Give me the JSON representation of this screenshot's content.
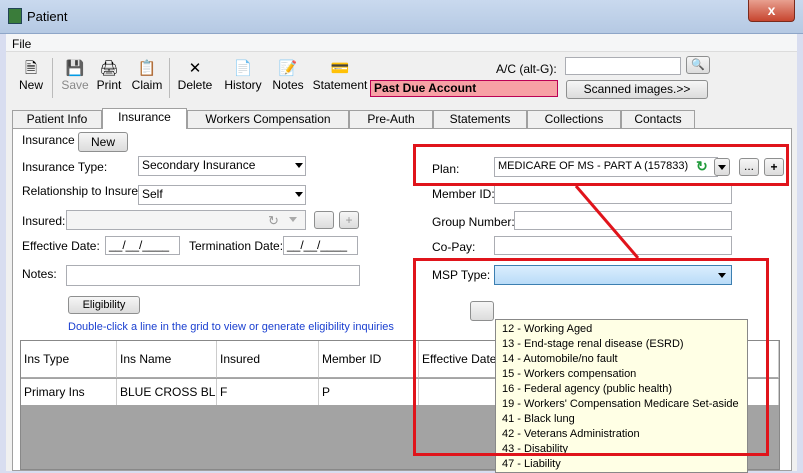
{
  "window": {
    "title": "Patient",
    "close": "x"
  },
  "menu": [
    "File"
  ],
  "toolbar": [
    {
      "label": "New",
      "icon": "new-doc-icon"
    },
    {
      "label": "Save",
      "icon": "save-icon"
    },
    {
      "label": "Print",
      "icon": "print-icon"
    },
    {
      "label": "Claim",
      "icon": "claim-icon"
    },
    {
      "label": "Delete",
      "icon": "delete-icon"
    },
    {
      "label": "History",
      "icon": "history-icon"
    },
    {
      "label": "Notes",
      "icon": "notes-icon"
    },
    {
      "label": "Statement",
      "icon": "statement-icon"
    }
  ],
  "account": {
    "past_due": "Past Due Account",
    "ac_label": "A/C (alt-G):",
    "ac_value": "",
    "scanned": "Scanned images.>>"
  },
  "tabs": [
    "Patient Info",
    "Insurance",
    "Workers Compensation",
    "Pre-Auth",
    "Statements",
    "Collections",
    "Contacts"
  ],
  "insurance": {
    "section": "Insurance",
    "new_btn": "New",
    "type_label": "Insurance Type:",
    "type_value": "Secondary Insurance",
    "relationship_label": "Relationship to Insured:",
    "relationship_value": "Self",
    "insured_label": "Insured:",
    "effective_label": "Effective Date:",
    "effective_value": "__/__/____",
    "termination_label": "Termination Date:",
    "termination_value": "__/__/____",
    "notes_label": "Notes:",
    "eligibility_btn": "Eligibility",
    "hint": "Double-click a line in the grid to view or generate eligibility inquiries",
    "plan_label": "Plan:",
    "plan_value": "MEDICARE OF MS - PART A (157833)",
    "member_label": "Member ID:",
    "group_label": "Group Number:",
    "copay_label": "Co-Pay:",
    "msp_label": "MSP Type:"
  },
  "msp_options": [
    "12 - Working Aged",
    "13 - End-stage renal disease (ESRD)",
    "14 - Automobile/no fault",
    "15 - Workers compensation",
    "16 - Federal agency (public health)",
    "19 - Workers' Compensation Medicare Set-aside",
    "41 - Black lung",
    "42 - Veterans Administration",
    "43 - Disability",
    "47 - Liability"
  ],
  "grid": {
    "columns": [
      "Ins Type",
      "Ins Name",
      "Insured",
      "Member ID",
      "Effective Date"
    ],
    "rows": [
      [
        "Primary Ins",
        "BLUE CROSS BL...",
        "F",
        "P",
        ""
      ]
    ]
  },
  "colors": {
    "highlight": "#e0141b",
    "past_due_bg": "#f7a1a5",
    "link": "#1a3fd0"
  }
}
